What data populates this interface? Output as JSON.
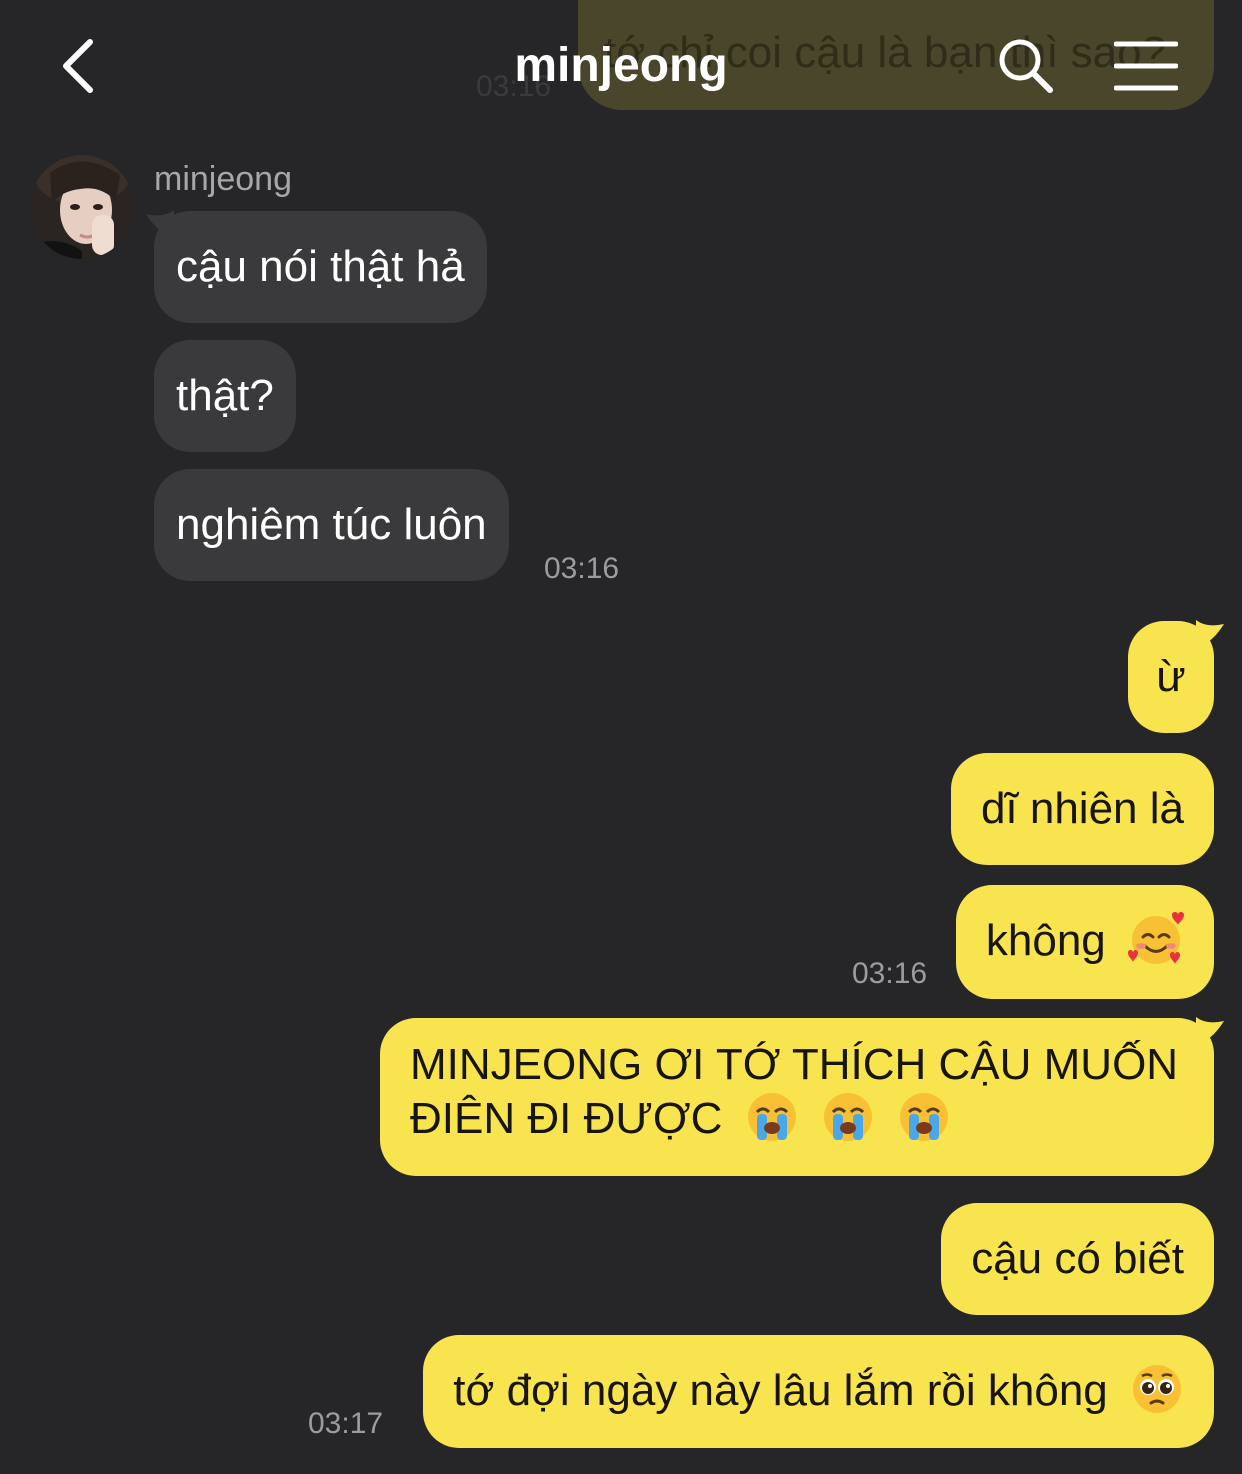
{
  "header": {
    "title": "minjeong",
    "behind_message_text": "tớ chỉ coi cậu là bạn thì sao?",
    "behind_message_time": "03:16"
  },
  "contact": {
    "name": "minjeong"
  },
  "incoming": [
    {
      "text": "cậu nói thật hả"
    },
    {
      "text": "thật?"
    },
    {
      "text": "nghiêm túc luôn"
    }
  ],
  "incoming_time": "03:16",
  "outgoing": [
    {
      "text": "ừ",
      "emoji": ""
    },
    {
      "text": "dĩ nhiên là",
      "emoji": ""
    },
    {
      "text": "không",
      "emoji": "smiling-face-with-hearts"
    },
    {
      "text": "MINJEONG ƠI TỚ THÍCH CẬU MUỐN ĐIÊN ĐI ĐƯỢC",
      "emoji": "loudly-crying-face x3"
    },
    {
      "text": "cậu có biết",
      "emoji": ""
    },
    {
      "text": "tớ đợi ngày này lâu lắm rồi không",
      "emoji": "pleading-face"
    }
  ],
  "times": {
    "block1": "03:16",
    "block2": "03:17"
  },
  "colors": {
    "background": "#262628",
    "incoming_bubble": "#3a3a3c",
    "outgoing_bubble": "#f8e44e",
    "timestamp": "#9c9ca0"
  }
}
